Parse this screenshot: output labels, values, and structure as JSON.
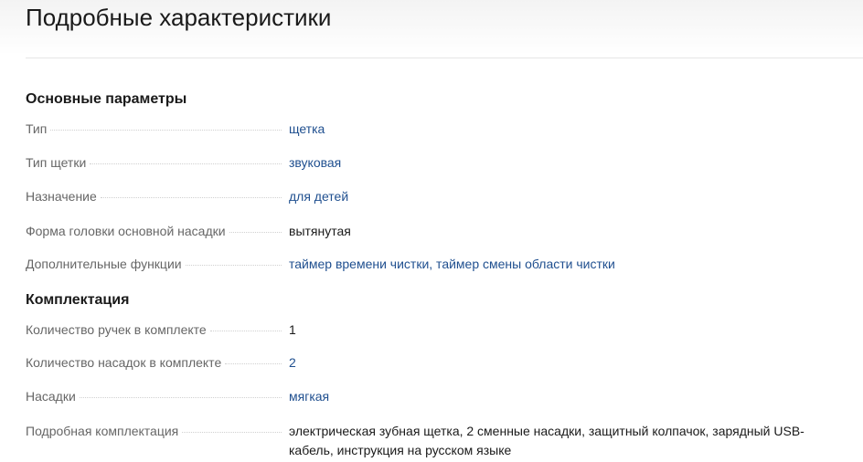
{
  "page": {
    "title": "Подробные характеристики"
  },
  "sections": [
    {
      "heading": "Основные параметры",
      "rows": [
        {
          "label": "Тип",
          "value": "щетка",
          "link": true
        },
        {
          "label": "Тип щетки",
          "value": "звуковая",
          "link": true
        },
        {
          "label": "Назначение",
          "value": "для детей",
          "link": true
        },
        {
          "label": "Форма головки основной насадки",
          "value": "вытянутая",
          "link": false
        },
        {
          "label": "Дополнительные функции",
          "value": "таймер времени чистки, таймер смены области чистки",
          "link": true
        }
      ]
    },
    {
      "heading": "Комплектация",
      "rows": [
        {
          "label": "Количество ручек в комплекте",
          "value": "1",
          "link": false
        },
        {
          "label": "Количество насадок в комплекте",
          "value": "2",
          "link": true
        },
        {
          "label": "Насадки",
          "value": "мягкая",
          "link": true
        },
        {
          "label": "Подробная комплектация",
          "value": "электрическая зубная щетка, 2 сменные насадки, защитный колпачок, зарядный USB-кабель, инструкция на русском языке",
          "link": false
        }
      ]
    }
  ],
  "colors": {
    "link": "#1f4f8f",
    "label": "#666666",
    "text": "#1a1a1a"
  }
}
